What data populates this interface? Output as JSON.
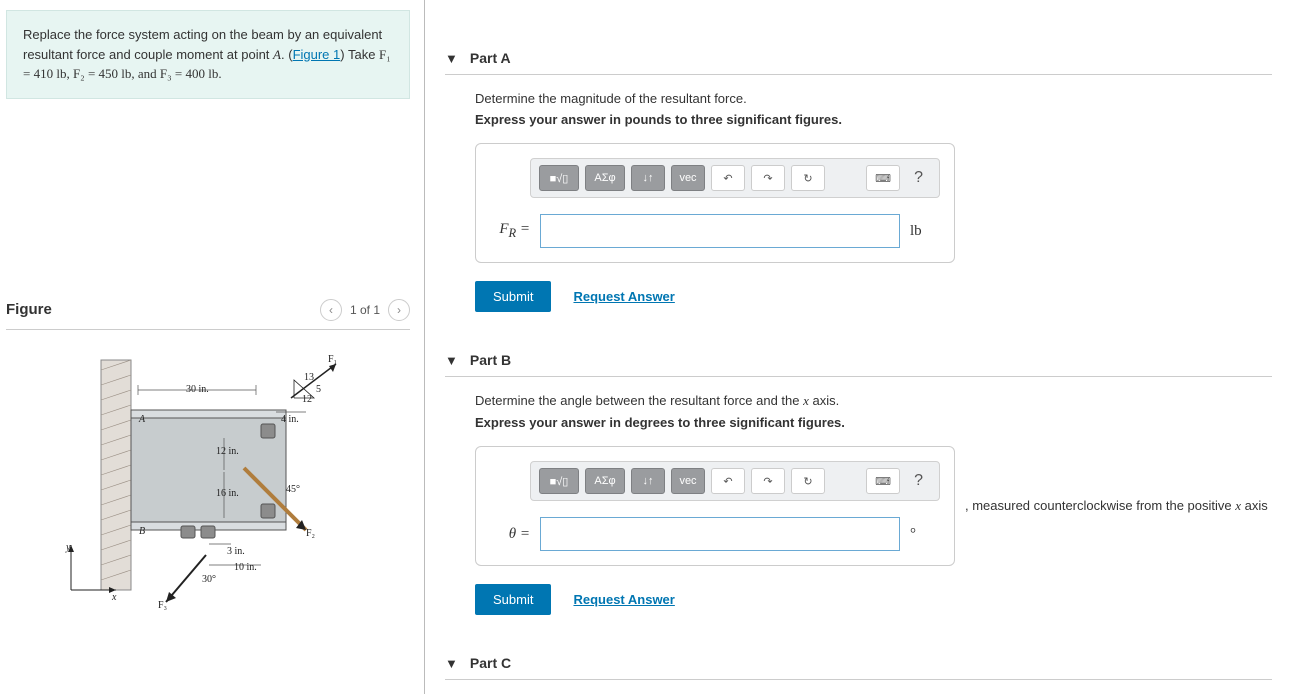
{
  "problem": {
    "text_prefix": "Replace the force system acting on the beam by an equivalent resultant force and couple moment at point ",
    "point_label": "A",
    "text_mid": ". (",
    "figure_link": "Figure 1",
    "text_after_link": ") Take ",
    "forces_text": "F₁ = 410 lb, F₂ = 450 lb, and F₃ = 400 lb."
  },
  "figure": {
    "heading": "Figure",
    "page_indicator": "1 of 1",
    "labels": {
      "A": "A",
      "B": "B",
      "F1": "F₁",
      "F2": "F₂",
      "F3": "F₃",
      "d30": "30 in.",
      "d4": "4 in.",
      "d12": "12 in.",
      "d16": "16 in.",
      "d3": "3 in.",
      "d10": "10 in.",
      "a45": "45°",
      "a30": "30°",
      "r13": "13",
      "r5": "5",
      "r12": "12",
      "x": "x",
      "y": "y"
    }
  },
  "partA": {
    "title": "Part A",
    "prompt": "Determine the magnitude of the resultant force.",
    "sub_prompt": "Express your answer in pounds to three significant figures.",
    "lhs": "F_R =",
    "unit": "lb",
    "submit": "Submit",
    "request": "Request Answer"
  },
  "partB": {
    "title": "Part B",
    "prompt_a": "Determine the angle between the resultant force and the ",
    "prompt_x": "x",
    "prompt_b": " axis.",
    "sub_prompt": "Express your answer in degrees to three significant figures.",
    "lhs": "θ =",
    "unit": "°",
    "suffix_a": ", measured counterclockwise from the positive ",
    "suffix_x": "x",
    "suffix_b": " axis",
    "submit": "Submit",
    "request": "Request Answer"
  },
  "partC": {
    "title": "Part C"
  },
  "toolbar": {
    "templates": "■√▯",
    "greek": "ΑΣφ",
    "subsup": "↓↑",
    "vec": "vec",
    "undo": "↶",
    "redo": "↷",
    "reset": "↻",
    "keyboard": "⌨",
    "help": "?"
  }
}
